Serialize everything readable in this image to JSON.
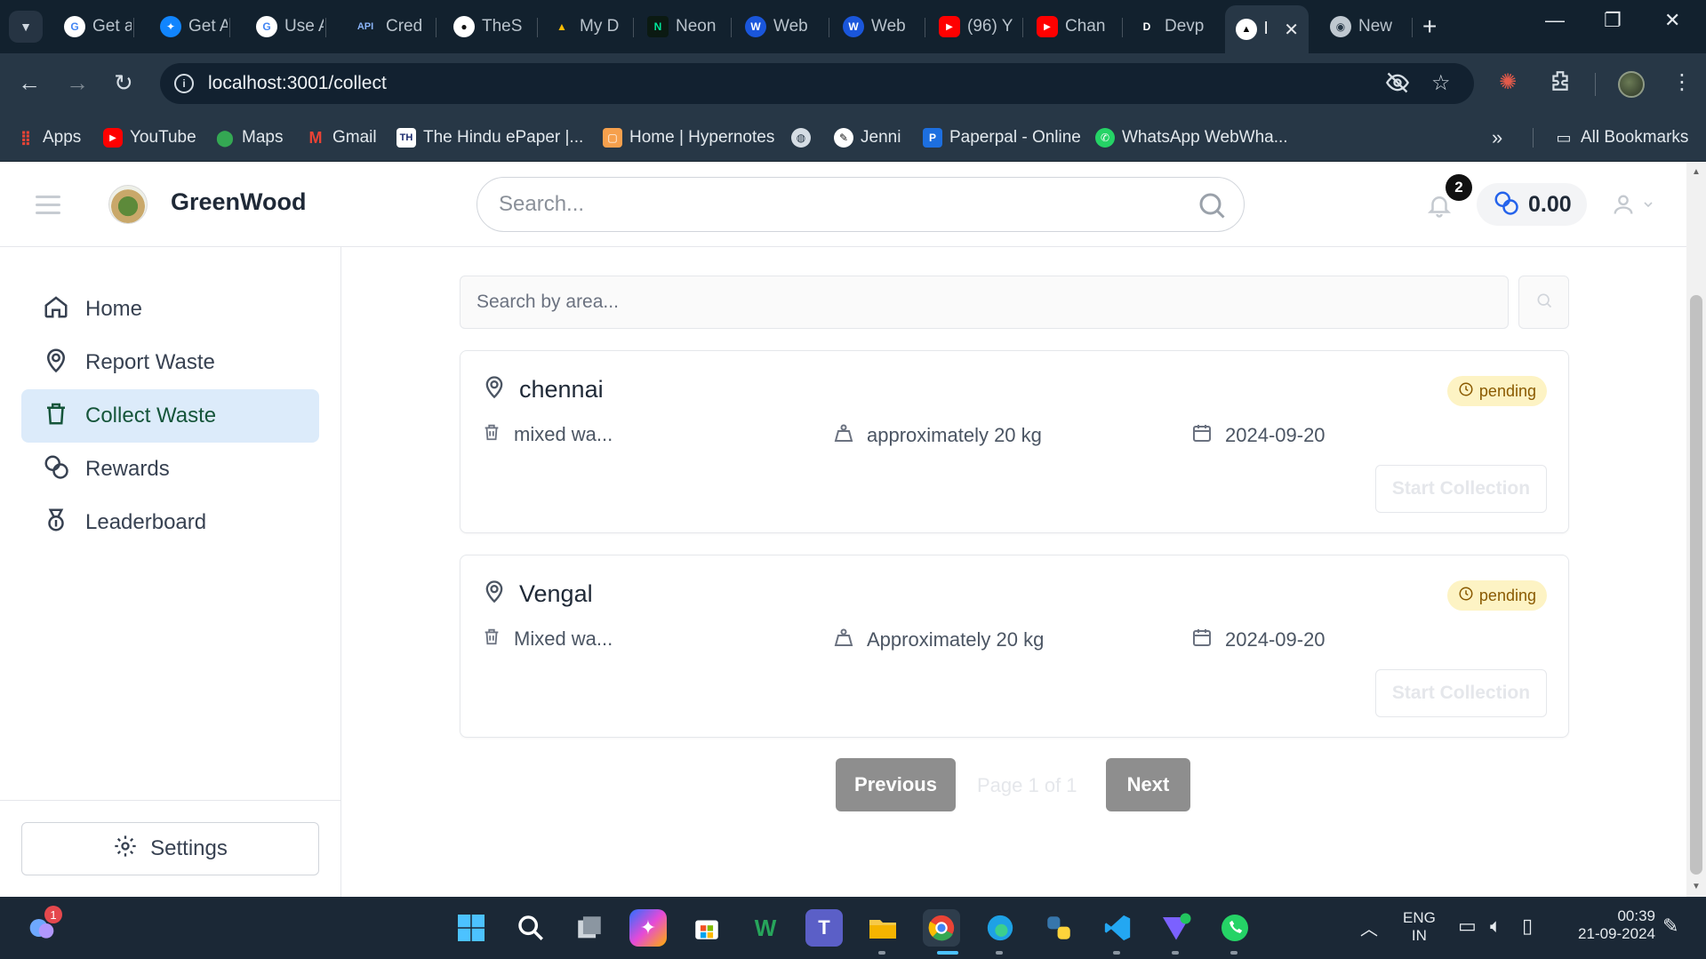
{
  "browser": {
    "tabs": [
      {
        "label": "Get a",
        "icon": "google-icon"
      },
      {
        "label": "Get A",
        "icon": "bluesky-icon"
      },
      {
        "label": "Use A",
        "icon": "google-icon"
      },
      {
        "label": "Cred",
        "icon": "api-icon"
      },
      {
        "label": "TheS",
        "icon": "github-icon"
      },
      {
        "label": "My D",
        "icon": "google-drive-icon"
      },
      {
        "label": "Neon",
        "icon": "neon-icon"
      },
      {
        "label": "Web",
        "icon": "w-icon"
      },
      {
        "label": "Web",
        "icon": "w-icon"
      },
      {
        "label": "(96) Y",
        "icon": "youtube-icon"
      },
      {
        "label": "Chan",
        "icon": "youtube-icon"
      },
      {
        "label": "Devp",
        "icon": "d-icon"
      },
      {
        "label": "l",
        "icon": "triangle-icon",
        "active": true
      },
      {
        "label": "New",
        "icon": "chrome-icon"
      }
    ],
    "url": "localhost:3001/collect",
    "bookmarks": [
      {
        "label": "Apps",
        "icon": "apps-grid-icon"
      },
      {
        "label": "YouTube",
        "icon": "youtube-icon"
      },
      {
        "label": "Maps",
        "icon": "maps-icon"
      },
      {
        "label": "Gmail",
        "icon": "gmail-icon"
      },
      {
        "label": "The Hindu ePaper |...",
        "icon": "hindu-icon"
      },
      {
        "label": "Home | Hypernotes",
        "icon": "hypernotes-icon"
      },
      {
        "label": "",
        "icon": "globe-icon"
      },
      {
        "label": "Jenni",
        "icon": "jenni-icon"
      },
      {
        "label": "Paperpal - Online",
        "icon": "paperpal-icon"
      },
      {
        "label": "WhatsApp WebWha...",
        "icon": "whatsapp-icon"
      }
    ],
    "more_bookmarks": "»",
    "all_bookmarks": "All Bookmarks"
  },
  "app": {
    "brand": "GreenWood",
    "search_placeholder": "Search...",
    "notification_count": "2",
    "balance": "0.00",
    "nav": [
      {
        "label": "Home",
        "icon": "home-icon"
      },
      {
        "label": "Report Waste",
        "icon": "map-pin-icon"
      },
      {
        "label": "Collect Waste",
        "icon": "trash-icon",
        "active": true
      },
      {
        "label": "Rewards",
        "icon": "coins-icon"
      },
      {
        "label": "Leaderboard",
        "icon": "medal-icon"
      }
    ],
    "settings_label": "Settings",
    "area_search_placeholder": "Search by area...",
    "tasks": [
      {
        "location": "chennai",
        "status": "pending",
        "waste_type": "mixed wa...",
        "amount": "approximately 20 kg",
        "date": "2024-09-20",
        "button": "Start Collection"
      },
      {
        "location": "Vengal",
        "status": "pending",
        "waste_type": "Mixed wa...",
        "amount": "Approximately 20 kg",
        "date": "2024-09-20",
        "button": "Start Collection"
      }
    ],
    "pagination": {
      "previous": "Previous",
      "page_text": "Page 1 of 1",
      "next": "Next"
    }
  },
  "taskbar": {
    "weather_badge": "1",
    "language": "ENG",
    "region": "IN",
    "time": "00:39",
    "date": "21-09-2024"
  },
  "colors": {
    "active_nav_bg": "#dcebfa",
    "active_nav_text": "#15553a",
    "pending_bg": "#fdf3c4",
    "pending_text": "#8a5a00",
    "pager_bg": "#8e8e8e"
  }
}
